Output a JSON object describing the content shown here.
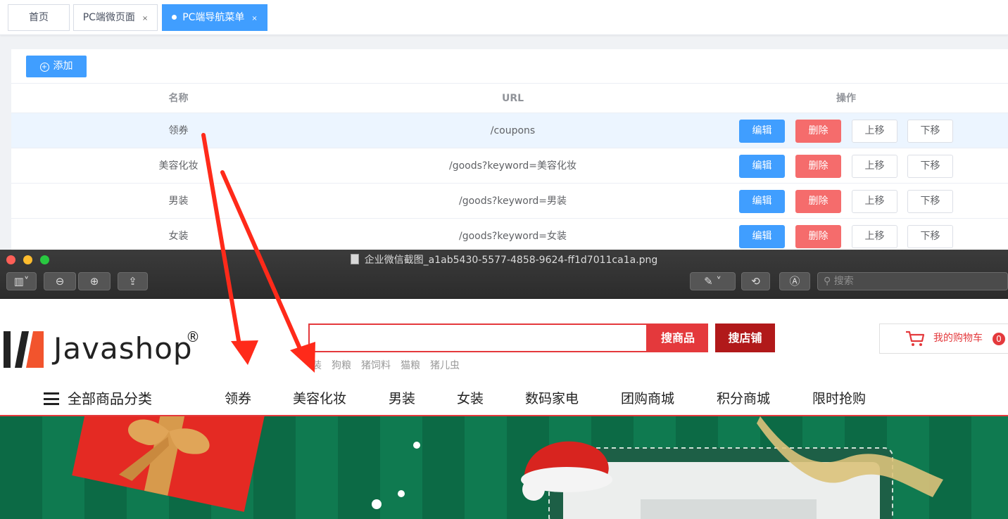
{
  "tabs": [
    {
      "label": "首页"
    },
    {
      "label": "PC端微页面",
      "close": "×"
    },
    {
      "label": "PC端导航菜单",
      "close": "×"
    }
  ],
  "toolbar": {
    "add_label": "添加",
    "add_icon": "plus-circle-icon"
  },
  "table": {
    "headers": {
      "name": "名称",
      "url": "URL",
      "ops": "操作"
    },
    "rows": [
      {
        "name": "领券",
        "url": "/coupons"
      },
      {
        "name": "美容化妆",
        "url": "/goods?keyword=美容化妆"
      },
      {
        "name": "男装",
        "url": "/goods?keyword=男装"
      },
      {
        "name": "女装",
        "url": "/goods?keyword=女装"
      }
    ],
    "actions": {
      "edit": "编辑",
      "delete": "删除",
      "up": "上移",
      "down": "下移"
    }
  },
  "preview_window": {
    "title": "企业微信截图_a1ab5430-5577-4858-9624-ff1d7011ca1a.png",
    "search_placeholder": "搜索",
    "toolbar_icons": [
      "sidebar-toggle-icon",
      "zoom-out-icon",
      "zoom-in-icon",
      "share-icon",
      "markup-pen-icon",
      "rotate-icon",
      "annotate-icon",
      "search-icon"
    ]
  },
  "shop": {
    "logo_text": "Javashop",
    "logo_reg": "®",
    "search_goods": "搜商品",
    "search_shop": "搜店铺",
    "hot_words": [
      "装",
      "狗粮",
      "猪饲料",
      "猫粮",
      "猪儿虫"
    ],
    "cart_label": "我的购物车",
    "cart_count": "0",
    "category_all": "全部商品分类",
    "nav": [
      "领券",
      "美容化妆",
      "男装",
      "女装",
      "数码家电",
      "团购商城",
      "积分商城",
      "限时抢购"
    ]
  },
  "colors": {
    "primary": "#409eff",
    "danger": "#f56c6c",
    "shop_red": "#e4393c",
    "shop_dark_red": "#b1191a",
    "arrow_red": "#ff2a1a",
    "banner_green": "#0c6a45"
  }
}
